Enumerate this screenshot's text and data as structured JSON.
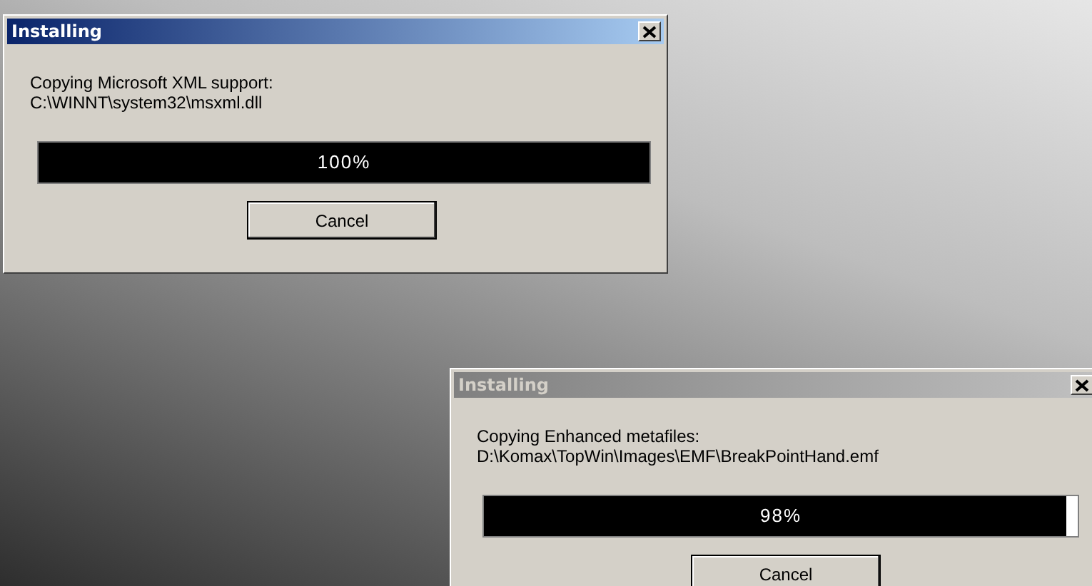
{
  "windows": [
    {
      "title": "Installing",
      "active": true,
      "message": "Copying Microsoft XML support:",
      "path": "C:\\WINNT\\system32\\msxml.dll",
      "progress": {
        "level": 1.0,
        "reading": "100%"
      },
      "button": "Cancel"
    },
    {
      "title": "Installing",
      "active": false,
      "message": "Copying Enhanced metafiles:",
      "path": "D:\\Komax\\TopWin\\Images\\EMF\\BreakPointHand.emf",
      "progress": {
        "level": 0.98,
        "reading": "98%"
      },
      "button": "Cancel"
    }
  ]
}
